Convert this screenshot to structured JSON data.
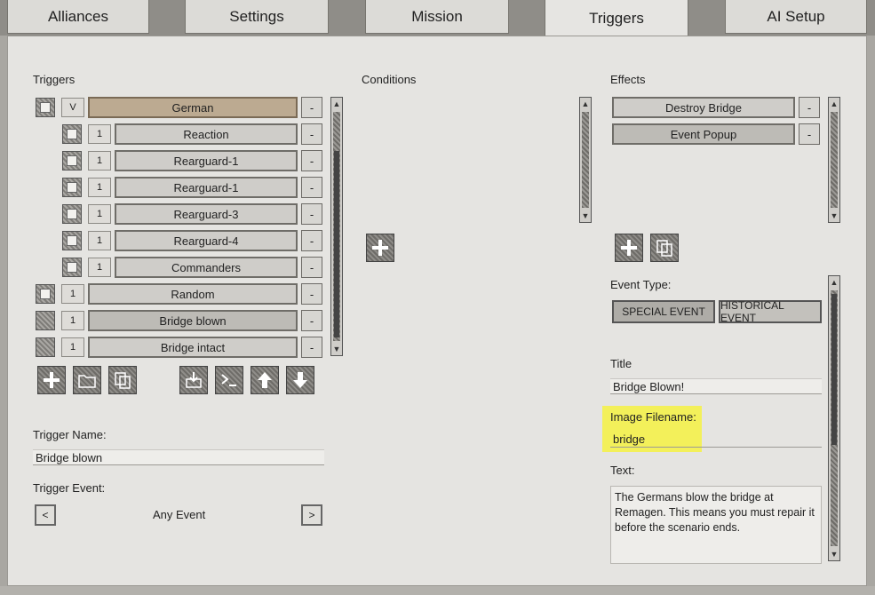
{
  "tabs": [
    {
      "label": "Alliances"
    },
    {
      "label": "Settings"
    },
    {
      "label": "Mission"
    },
    {
      "label": "Triggers"
    },
    {
      "label": "AI Setup"
    }
  ],
  "active_tab": "Triggers",
  "triggers": {
    "heading": "Triggers",
    "items": [
      {
        "count": "V",
        "label": "German",
        "selected": true
      },
      {
        "count": "1",
        "label": "Reaction"
      },
      {
        "count": "1",
        "label": "Rearguard-1"
      },
      {
        "count": "1",
        "label": "Rearguard-1"
      },
      {
        "count": "1",
        "label": "Rearguard-3"
      },
      {
        "count": "1",
        "label": "Rearguard-4"
      },
      {
        "count": "1",
        "label": "Commanders"
      },
      {
        "count": "1",
        "label": "Random"
      },
      {
        "count": "1",
        "label": "Bridge blown"
      },
      {
        "count": "1",
        "label": "Bridge intact"
      }
    ],
    "remove_label": "-",
    "name_label": "Trigger Name:",
    "name_value": "Bridge blown",
    "event_label": "Trigger Event:",
    "event_value": "Any Event",
    "prev_label": "<",
    "next_label": ">"
  },
  "conditions": {
    "heading": "Conditions"
  },
  "effects": {
    "heading": "Effects",
    "items": [
      {
        "label": "Destroy Bridge"
      },
      {
        "label": "Event Popup"
      }
    ],
    "remove_label": "-",
    "event_type_label": "Event Type:",
    "special_event": "SPECIAL EVENT",
    "historical_event": "HISTORICAL EVENT",
    "title_label": "Title",
    "title_value": "Bridge Blown!",
    "image_label": "Image Filename:",
    "image_value": "bridge",
    "text_label": "Text:",
    "text_value": "The Germans blow the bridge at Remagen. This means you must repair it before the scenario ends."
  },
  "colors": {
    "highlight": "#f3f05a",
    "selected_trigger": "#bcaa91"
  }
}
